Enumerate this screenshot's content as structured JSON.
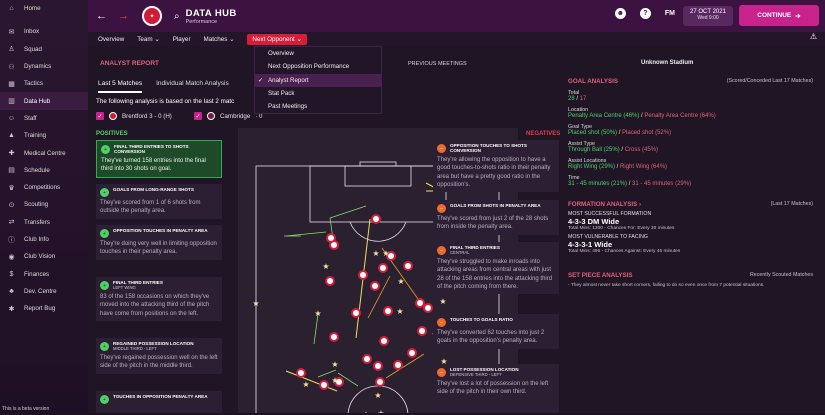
{
  "sidebar": {
    "items": [
      {
        "label": "Home",
        "icon": "house"
      },
      {
        "label": "Inbox",
        "icon": "envelope"
      },
      {
        "label": "Squad",
        "icon": "shirt"
      },
      {
        "label": "Dynamics",
        "icon": "people"
      },
      {
        "label": "Tactics",
        "icon": "board"
      },
      {
        "label": "Data Hub",
        "icon": "chart"
      },
      {
        "label": "Staff",
        "icon": "person"
      },
      {
        "label": "Training",
        "icon": "cone"
      },
      {
        "label": "Medical Centre",
        "icon": "cross"
      },
      {
        "label": "Schedule",
        "icon": "calendar"
      },
      {
        "label": "Competitions",
        "icon": "trophy"
      },
      {
        "label": "Scouting",
        "icon": "binoculars"
      },
      {
        "label": "Transfers",
        "icon": "arrows"
      },
      {
        "label": "Club Info",
        "icon": "info"
      },
      {
        "label": "Club Vision",
        "icon": "eye"
      },
      {
        "label": "Finances",
        "icon": "money"
      },
      {
        "label": "Dev. Centre",
        "icon": "sprout"
      },
      {
        "label": "Report Bug",
        "icon": "bug"
      }
    ],
    "beta_note": "This is a beta version"
  },
  "topbar": {
    "title": "DATA HUB",
    "subtitle": "Performance",
    "fm_label": "FM",
    "date": "27 OCT 2021",
    "day_time": "Wed 9:00",
    "continue_label": "CONTINUE"
  },
  "subnav": {
    "overview": "Overview",
    "team": "Team",
    "player": "Player",
    "matches": "Matches",
    "next_opponent": "Next Opponent"
  },
  "dropdown": {
    "items": [
      "Overview",
      "Next Opposition Performance",
      "Analyst Report",
      "Stat Pack",
      "Past Meetings"
    ],
    "selected": "Analyst Report"
  },
  "main": {
    "analyst_report": "ANALYST REPORT",
    "previous_meetings": "PREVIOUS MEETINGS",
    "stadium": "Unknown Stadium",
    "tabs": [
      "Last 5 Matches",
      "Individual Match Analysis"
    ],
    "basis_text": "The following analysis is based on the last 2 matc",
    "match1": "Brentford  3 - 0 (H)",
    "match2": "Cambridge",
    "match2_tail": "· 0",
    "positives": "POSITIVES",
    "negatives": "NEGATIVES"
  },
  "positives": [
    {
      "title": "FINAL THIRD ENTRIES TO SHOTS CONVERSION",
      "sub": "",
      "body": "They've turned 158 entries into the final third into 30 shots on goal."
    },
    {
      "title": "GOALS FROM LONG-RANGE SHOTS",
      "sub": "",
      "body": "They've scored from 1 of 6 shots from outside the penalty area."
    },
    {
      "title": "OPPOSITION TOUCHES IN PENALTY AREA",
      "sub": "",
      "body": "They're doing very well in limiting opposition touches in their penalty area."
    },
    {
      "title": "FINAL THIRD ENTRIES",
      "sub": "LEFT WING",
      "body": "83 of the 158 occasions on which they've moved into the attacking third of the pitch have come from positions on the left."
    },
    {
      "title": "REGAINED POSSESSION LOCATION",
      "sub": "MIDDLE THIRD - LEFT",
      "body": "They've regained possession well on the left side of the pitch in the middle third."
    },
    {
      "title": "TOUCHES IN OPPOSITION PENALTY AREA",
      "sub": "",
      "body": ""
    }
  ],
  "negatives": [
    {
      "title": "OPPOSITION TOUCHES TO SHOTS CONVERSION",
      "sub": "",
      "body": "They're allowing the opposition to have a good touches-to-shots ratio in their penalty area but have a pretty good ratio in the opposition's."
    },
    {
      "title": "GOALS FROM SHOTS IN PENALTY AREA",
      "sub": "",
      "body": "They've scored from just 2 of the 28 shots from inside the penalty area."
    },
    {
      "title": "FINAL THIRD ENTRIES",
      "sub": "CENTRAL",
      "body": "They've struggled to make inroads into attacking areas from central areas with just 28 of the 158 entries into the attacking third of the pitch coming from there."
    },
    {
      "title": "TOUCHES TO GOALS RATIO",
      "sub": "",
      "body": "They've converted 62 touches into just 2 goals in the opposition's penalty area."
    },
    {
      "title": "LOST POSSESSION LOCATION",
      "sub": "DEFENSIVE THIRD - LEFT",
      "body": "They've lost a lot of possession on the left side of the pitch in their own third."
    }
  ],
  "goal_analysis": {
    "heading": "GOAL ANALYSIS",
    "note": "(Scored/Conceded Last 17 Matches)",
    "total_label": "Total",
    "total_scored": "28",
    "total_conceded": "17",
    "location_label": "Location",
    "location_scored": "Penalty Area Centre (46%)",
    "location_conceded": "Penalty Area Centre (64%)",
    "goal_type_label": "Goal Type",
    "goal_type_scored": "Placed shot (50%)",
    "goal_type_conceded": "Placed shot (52%)",
    "assist_type_label": "Assist Type",
    "assist_type_scored": "Through Ball (25%)",
    "assist_type_conceded": "Cross (45%)",
    "assist_loc_label": "Assist Locations",
    "assist_loc_scored": "Right Wing (29%)",
    "assist_loc_conceded": "Right Wing (64%)",
    "time_label": "Time",
    "time_scored": "31 - 45 minutes (21%)",
    "time_conceded": "31 - 45 minutes (29%)"
  },
  "formation": {
    "heading": "FORMATION ANALYSIS",
    "note": "(Last 17 Matches)",
    "successful_label": "MOST SUCCESSFUL FORMATION",
    "successful_value": "4-3-3 DM Wide",
    "successful_detail": "Total Mins: 1300 - Chances For: Every 30 minutes",
    "vulnerable_label": "MOST VULNERABLE TO FACING",
    "vulnerable_value": "4-3-3-1 Wide",
    "vulnerable_detail": "Total Mins: 496 - Chances Against: Every 45 minutes"
  },
  "set_piece": {
    "heading": "SET PIECE ANALYSIS",
    "note": "Recently Scouted Matches",
    "body": "- They almost never take short corners, failing to do so even once from 7 potential situations."
  },
  "colors": {
    "accent": "#c8228c",
    "positive": "#4fd06a",
    "negative": "#e23a4a",
    "heading": "#e0637a"
  }
}
